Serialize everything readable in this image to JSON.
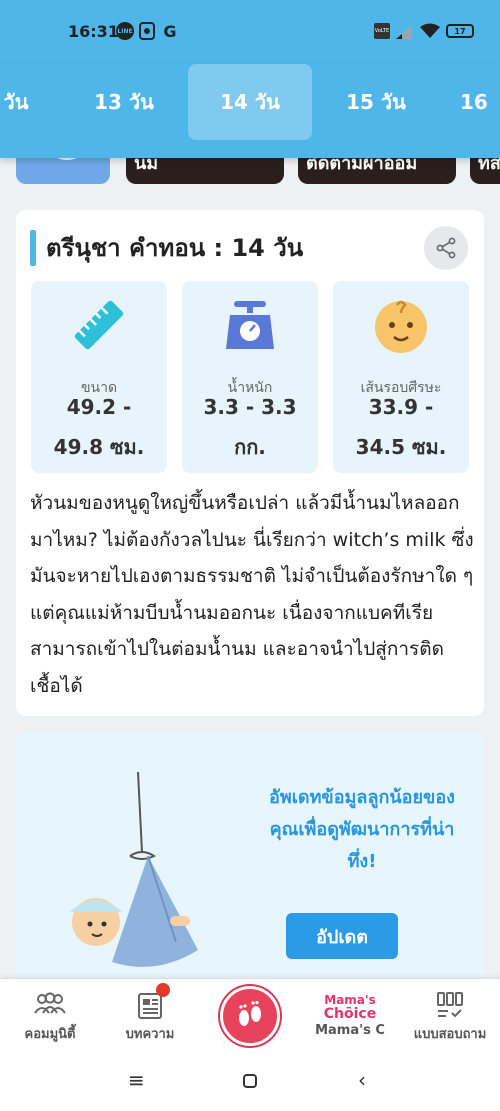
{
  "status_bar": {
    "time": "16:31",
    "line_badge": "LINE",
    "g_badge": "G",
    "volte": "VoLTE",
    "battery": "17"
  },
  "tabs": [
    {
      "label": "วัน"
    },
    {
      "label": "13 วัน"
    },
    {
      "label": "14 วัน",
      "active": true
    },
    {
      "label": "15 วัน"
    },
    {
      "label": "16"
    }
  ],
  "strip": {
    "card1_text": "นม",
    "card2_text": "ติดตามผ้าอ้อม",
    "card3_text": "ทส"
  },
  "article": {
    "title": "ตรีนุชา คำทอน : 14 วัน",
    "stats": [
      {
        "label": "ขนาด",
        "value_line1": "49.2 -",
        "value_line2": "49.8 ซม.",
        "icon": "ruler-icon"
      },
      {
        "label": "น้ำหนัก",
        "value_line1": "3.3 - 3.3",
        "value_line2": "กก.",
        "icon": "scale-icon"
      },
      {
        "label": "เส้นรอบศีรษะ",
        "value_line1": "33.9 -",
        "value_line2": "34.5 ซม.",
        "icon": "baby-face-icon"
      }
    ],
    "paragraph": "หัวนมของหนูดูใหญ่ขึ้นหรือเปล่า แล้วมีน้ำนมไหลออกมาไหม? ไม่ต้องกังวลไปนะ นี่เรียกว่า witch’s milk ซึ่งมันจะหายไปเองตามธรรมชาติ ไม่จำเป็นต้องรักษาใด ๆ แต่คุณแม่ห้ามบีบน้ำนมออกนะ เนื่องจากแบคทีเรียสามารถเข้าไปในต่อมน้ำนม และอาจนำไปสู่การติดเชื้อได้"
  },
  "promo": {
    "text": "อัพเดทข้อมูลลูกน้อยของคุณเพื่อดูพัฒนาการที่น่าทึ่ง!",
    "button_label": "อัปเดต"
  },
  "bottom_nav": [
    {
      "label": "คอมมูนิตี้",
      "icon": "community-icon"
    },
    {
      "label": "บทความ",
      "icon": "article-icon"
    },
    {
      "label": "",
      "icon": "footprints-icon"
    },
    {
      "label": "Mama's C",
      "icon": "mamas-choice-logo",
      "logo_line1": "Mama's",
      "logo_line2": "Chōice"
    },
    {
      "label": "แบบสอบถาม",
      "icon": "survey-icon"
    }
  ],
  "colors": {
    "header": "#4fb6ea",
    "accent": "#2b9be8",
    "center_button": "#e8435d",
    "mamas_pink": "#e3346f"
  }
}
